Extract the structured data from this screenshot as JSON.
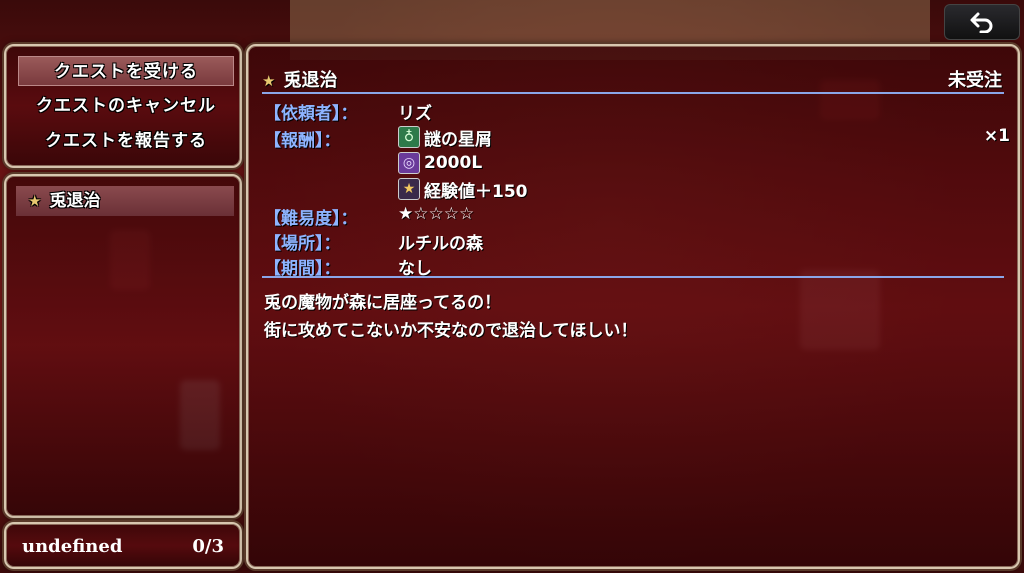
{
  "menu": {
    "items": [
      {
        "label": "クエストを受ける",
        "selected": true
      },
      {
        "label": "クエストのキャンセル",
        "selected": false
      },
      {
        "label": "クエストを報告する",
        "selected": false
      }
    ]
  },
  "quest_list": {
    "items": [
      {
        "icon": "star-icon",
        "label": "兎退治"
      }
    ]
  },
  "footer": {
    "label": "undefined",
    "count": "0/3"
  },
  "detail": {
    "title": "兎退治",
    "status": "未受注",
    "client_label": "【依頼者】：",
    "client_value": "リズ",
    "reward_label": "【報酬】：",
    "rewards": [
      {
        "icon": "item-bag-icon",
        "text": "謎の星屑",
        "quantity": "×1"
      },
      {
        "icon": "coin-icon",
        "text": "2000L",
        "quantity": ""
      },
      {
        "icon": "exp-star-icon",
        "text": "経験値＋150",
        "quantity": ""
      }
    ],
    "difficulty_label": "【難易度】：",
    "difficulty_value": "★☆☆☆☆",
    "place_label": "【場所】：",
    "place_value": "ルチルの森",
    "period_label": "【期間】：",
    "period_value": "なし",
    "description": [
      "兎の魔物が森に居座ってるの！",
      "街に攻めてこないか不安なので退治してほしい！"
    ]
  },
  "back_button": {
    "icon": "back-arrow-icon"
  },
  "colors": {
    "label_blue": "#8eb4ff",
    "panel_red": "#5a080c",
    "frame_gold": "#d8c7b0"
  }
}
